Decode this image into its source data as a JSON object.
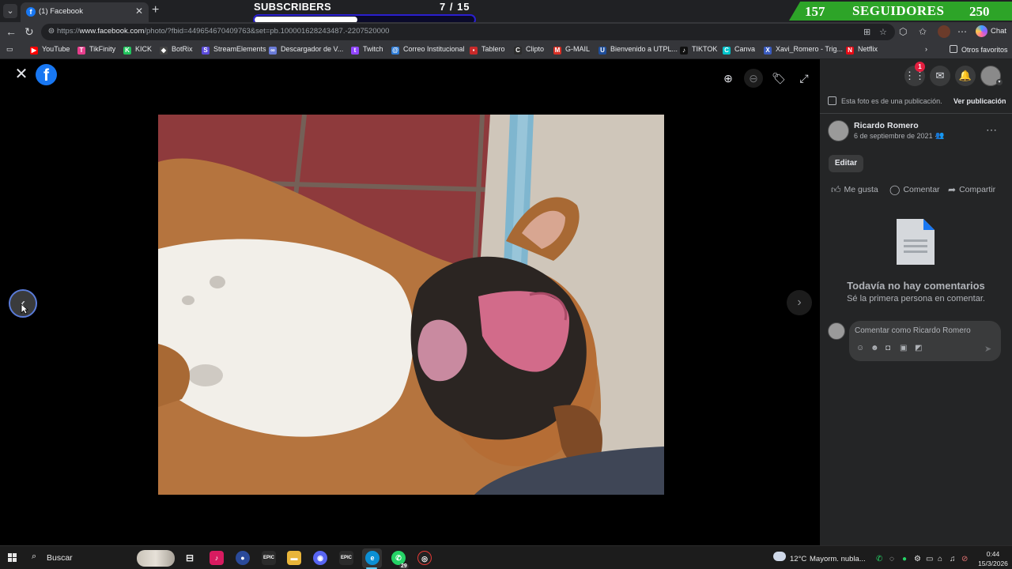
{
  "browser": {
    "tab_title": "(1) Facebook",
    "url_prefix": "https://",
    "url_domain": "www.facebook.com",
    "url_rest": "/photo/?fbid=449654670409763&set=pb.100001628243487.-2207520000",
    "copilot_label": "Chat"
  },
  "stream_overlay": {
    "subscribers_label": "SUBSCRIBERS",
    "subscribers_count": "7 / 15",
    "subscribers_progress": 0.467,
    "followers_left": "157",
    "followers_label": "SEGUIDORES",
    "followers_right": "250",
    "banner_color": "#2da428",
    "bar_border_color": "#2a1fd0"
  },
  "bookmarks": [
    {
      "label": "YouTube",
      "icon": "youtube-icon",
      "color": "#ff0000",
      "glyph": "▶"
    },
    {
      "label": "TikFinity",
      "icon": "tikfinity-icon",
      "color": "#e83e8c",
      "glyph": "T"
    },
    {
      "label": "KICK",
      "icon": "kick-icon",
      "color": "#22c55e",
      "glyph": "K"
    },
    {
      "label": "BotRix",
      "icon": "botrix-icon",
      "color": "#444444",
      "glyph": "◆"
    },
    {
      "label": "StreamElements",
      "icon": "streamelements-icon",
      "color": "#5b4bdb",
      "glyph": "S"
    },
    {
      "label": "Descargador de V...",
      "icon": "downloader-icon",
      "color": "#6a7bd8",
      "glyph": "∞"
    },
    {
      "label": "Twitch",
      "icon": "twitch-icon",
      "color": "#9146ff",
      "glyph": "t"
    },
    {
      "label": "Correo Institucional",
      "icon": "mail-icon",
      "color": "#2d7bd6",
      "glyph": "@"
    },
    {
      "label": "Tablero",
      "icon": "tablero-icon",
      "color": "#c92a2a",
      "glyph": "▪"
    },
    {
      "label": "Clipto",
      "icon": "clipto-icon",
      "color": "#2c2c2c",
      "glyph": "C"
    },
    {
      "label": "G-MAIL",
      "icon": "gmail-icon",
      "color": "#d93025",
      "glyph": "M"
    },
    {
      "label": "Bienvenido a UTPL...",
      "icon": "utpl-icon",
      "color": "#1f4e9a",
      "glyph": "U"
    },
    {
      "label": "TIKTOK",
      "icon": "tiktok-icon",
      "color": "#111111",
      "glyph": "♪"
    },
    {
      "label": "Canva",
      "icon": "canva-icon",
      "color": "#00c4cc",
      "glyph": "C"
    },
    {
      "label": "Xavi_Romero - Trig...",
      "icon": "page-icon",
      "color": "#3a5bbf",
      "glyph": "X"
    },
    {
      "label": "Netflix",
      "icon": "netflix-icon",
      "color": "#e50914",
      "glyph": "N"
    }
  ],
  "bookmarks_other": "Otros favoritos",
  "panel": {
    "post_note": "Esta foto es de una publicación.",
    "view_post": "Ver publicación",
    "author": "Ricardo Romero",
    "date": "6 de septiembre de 2021 ·",
    "edit": "Editar",
    "like": "Me gusta",
    "comment": "Comentar",
    "share": "Compartir",
    "empty_title": "Todavía no hay comentarios",
    "empty_subtitle": "Sé la primera persona en comentar.",
    "composer_placeholder": "Comentar como Ricardo Romero",
    "messenger_badge": "1"
  },
  "taskbar": {
    "search_label": "Buscar",
    "whatsapp_badge": "29",
    "temperature": "12°C",
    "weather": "Mayorm. nubla...",
    "time": "0:44",
    "date": "15/3/2026"
  }
}
